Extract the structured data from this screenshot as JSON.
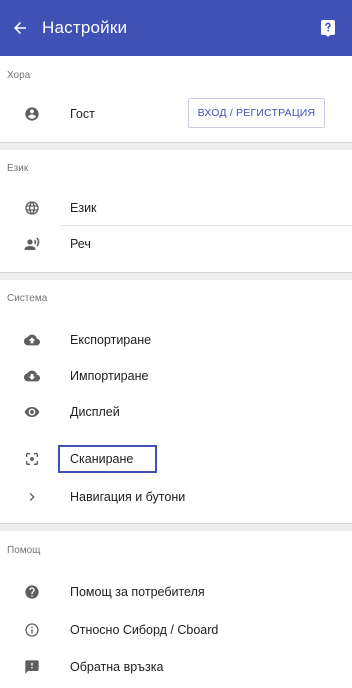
{
  "appbar": {
    "title": "Настройки"
  },
  "sections": {
    "people": {
      "label": "Хора",
      "guest_label": "Гост",
      "login_button": "ВХОД / РЕГИСТРАЦИЯ"
    },
    "language": {
      "label": "Език",
      "items": [
        "Език",
        "Реч"
      ]
    },
    "system": {
      "label": "Система",
      "items": [
        "Експортиране",
        "Импортиране",
        "Дисплей",
        "Сканиране",
        "Навигация и бутони"
      ]
    },
    "help": {
      "label": "Помощ",
      "items": [
        "Помощ за потребителя",
        "Относно Сиборд / Cboard",
        "Обратна връзка"
      ]
    }
  },
  "colors": {
    "primary": "#3f51b5",
    "icon": "#5f5f5f"
  },
  "icons": {
    "back": "arrow-left-icon",
    "help": "help-box-icon",
    "guest": "account-circle-icon",
    "language": "globe-icon",
    "speech": "record-voice-icon",
    "export": "cloud-upload-icon",
    "import": "cloud-download-icon",
    "display": "eye-icon",
    "scanning": "center-focus-icon",
    "navigation": "chevron-right-icon",
    "user_help": "help-circle-icon",
    "about": "info-outline-icon",
    "feedback": "feedback-icon"
  }
}
